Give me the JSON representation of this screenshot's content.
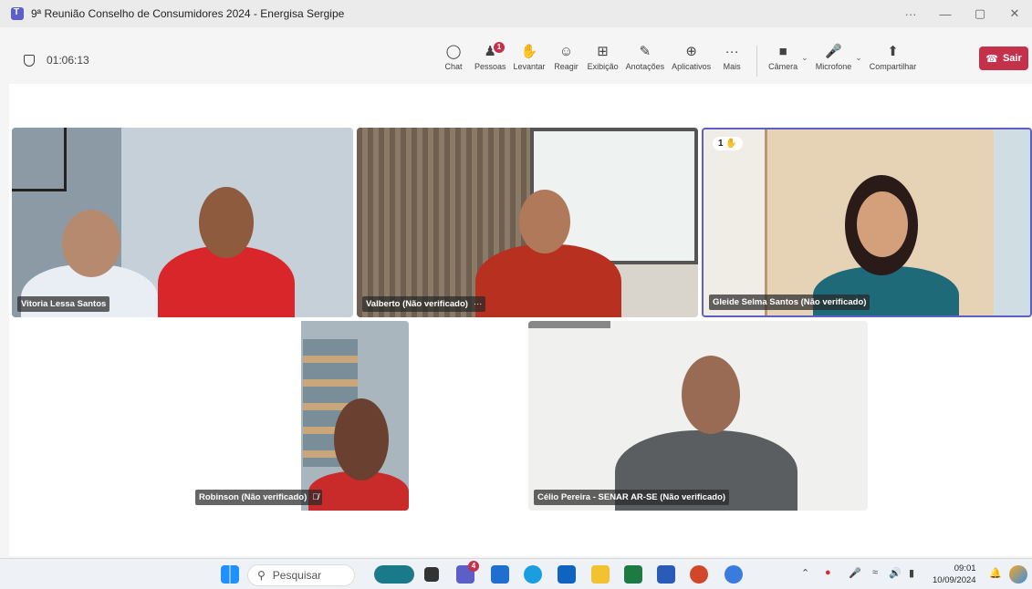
{
  "window": {
    "title": "9ª Reunião Conselho de Consumidores 2024 - Energisa Sergipe",
    "more": "···",
    "minimize": "—",
    "restore": "▢",
    "close": "✕"
  },
  "meeting": {
    "elapsed": "01:06:13",
    "toolbar": [
      {
        "id": "chat",
        "label": "Chat",
        "icon": "☺"
      },
      {
        "id": "people",
        "label": "Pessoas",
        "icon": "⚇",
        "badge": "1"
      },
      {
        "id": "raise",
        "label": "Levantar",
        "icon": "✋"
      },
      {
        "id": "react",
        "label": "Reagir",
        "icon": "☺"
      },
      {
        "id": "view",
        "label": "Exibição",
        "icon": "⊞"
      },
      {
        "id": "notes",
        "label": "Anotações",
        "icon": "✎"
      },
      {
        "id": "apps",
        "label": "Aplicativos",
        "icon": "⊕"
      },
      {
        "id": "more",
        "label": "Mais",
        "icon": "···"
      }
    ],
    "camera_label": "Câmera",
    "mic_label": "Microfone",
    "share_label": "Compartilhar",
    "leave_label": "Sair",
    "colors": {
      "leave": "#c4314b",
      "accent": "#5b5fc7",
      "badge": "#c4314b"
    }
  },
  "participants": [
    {
      "name": "Vitoria Lessa Santos",
      "extra": ""
    },
    {
      "name": "Valberto (Não verificado)",
      "extra": "···"
    },
    {
      "name": "Gleide Selma Santos (Não verificado)",
      "extra": "",
      "hand_count": "1",
      "hand_icon": "✋"
    },
    {
      "name": "Robinson (Não verificado)",
      "extra": "🎙̸"
    },
    {
      "name": "Célio Pereira - SENAR AR-SE (Não verificado)",
      "extra": ""
    }
  ],
  "taskbar": {
    "search_placeholder": "Pesquisar",
    "teams_badge": "4",
    "time": "09:01",
    "date": "10/09/2024"
  }
}
